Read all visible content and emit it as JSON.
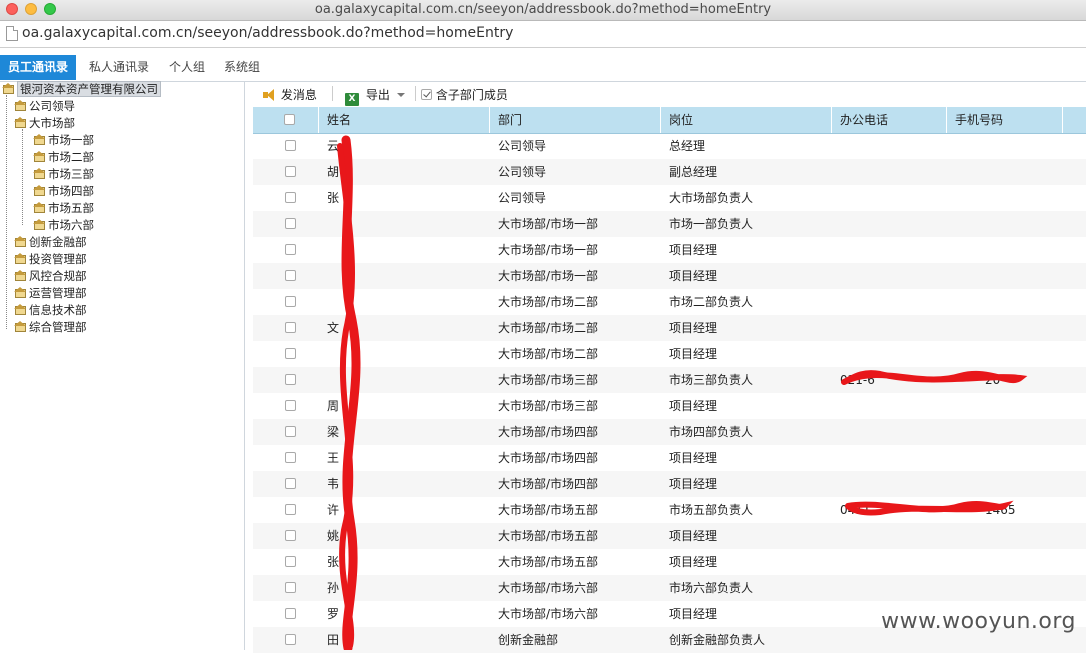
{
  "window": {
    "title": "oa.galaxycapital.com.cn/seeyon/addressbook.do?method=homeEntry"
  },
  "urlbar": {
    "url": "oa.galaxycapital.com.cn/seeyon/addressbook.do?method=homeEntry"
  },
  "tabs": [
    {
      "label": "员工通讯录",
      "active": true
    },
    {
      "label": "私人通讯录",
      "active": false
    },
    {
      "label": "个人组",
      "active": false
    },
    {
      "label": "系统组",
      "active": false
    }
  ],
  "tree": {
    "root": "银河资本资产管理有限公司",
    "nodes": [
      "公司领导",
      "大市场部",
      "市场一部",
      "市场二部",
      "市场三部",
      "市场四部",
      "市场五部",
      "市场六部",
      "创新金融部",
      "投资管理部",
      "风控合规部",
      "运营管理部",
      "信息技术部",
      "综合管理部"
    ]
  },
  "toolbar": {
    "send_message": "发消息",
    "export": "导出",
    "include_sub_dept": "含子部门成员"
  },
  "table": {
    "columns": [
      "姓名",
      "部门",
      "岗位",
      "办公电话",
      "手机号码"
    ],
    "rows": [
      {
        "name": "云",
        "dept": "公司领导",
        "post": "总经理",
        "office": "",
        "mobile": ""
      },
      {
        "name": "胡",
        "dept": "公司领导",
        "post": "副总经理",
        "office": "",
        "mobile": ""
      },
      {
        "name": "张",
        "dept": "公司领导",
        "post": "大市场部负责人",
        "office": "",
        "mobile": ""
      },
      {
        "name": "",
        "dept": "大市场部/市场一部",
        "post": "市场一部负责人",
        "office": "",
        "mobile": ""
      },
      {
        "name": "",
        "dept": "大市场部/市场一部",
        "post": "项目经理",
        "office": "",
        "mobile": ""
      },
      {
        "name": "",
        "dept": "大市场部/市场一部",
        "post": "项目经理",
        "office": "",
        "mobile": ""
      },
      {
        "name": "",
        "dept": "大市场部/市场二部",
        "post": "市场二部负责人",
        "office": "",
        "mobile": ""
      },
      {
        "name": "文",
        "dept": "大市场部/市场二部",
        "post": "项目经理",
        "office": "",
        "mobile": ""
      },
      {
        "name": "",
        "dept": "大市场部/市场二部",
        "post": "项目经理",
        "office": "",
        "mobile": ""
      },
      {
        "name": "",
        "dept": "大市场部/市场三部",
        "post": "市场三部负责人",
        "office": "021-6",
        "mobile": "20"
      },
      {
        "name": "周",
        "dept": "大市场部/市场三部",
        "post": "项目经理",
        "office": "",
        "mobile": ""
      },
      {
        "name": "梁",
        "dept": "大市场部/市场四部",
        "post": "市场四部负责人",
        "office": "",
        "mobile": ""
      },
      {
        "name": "王",
        "dept": "大市场部/市场四部",
        "post": "项目经理",
        "office": "",
        "mobile": ""
      },
      {
        "name": "韦",
        "dept": "大市场部/市场四部",
        "post": "项目经理",
        "office": "",
        "mobile": ""
      },
      {
        "name": "许",
        "dept": "大市场部/市场五部",
        "post": "市场五部负责人",
        "office": "0411-",
        "mobile": "1465"
      },
      {
        "name": "姚",
        "dept": "大市场部/市场五部",
        "post": "项目经理",
        "office": "",
        "mobile": ""
      },
      {
        "name": "张",
        "dept": "大市场部/市场五部",
        "post": "项目经理",
        "office": "",
        "mobile": ""
      },
      {
        "name": "孙",
        "dept": "大市场部/市场六部",
        "post": "市场六部负责人",
        "office": "",
        "mobile": ""
      },
      {
        "name": "罗",
        "dept": "大市场部/市场六部",
        "post": "项目经理",
        "office": "",
        "mobile": ""
      },
      {
        "name": "田",
        "dept": "创新金融部",
        "post": "创新金融部负责人",
        "office": "",
        "mobile": ""
      }
    ]
  },
  "watermark": "www.wooyun.org",
  "colors": {
    "tab_active": "#1e88d8",
    "header_bg": "#bde0f0",
    "redact": "#e8171a"
  }
}
